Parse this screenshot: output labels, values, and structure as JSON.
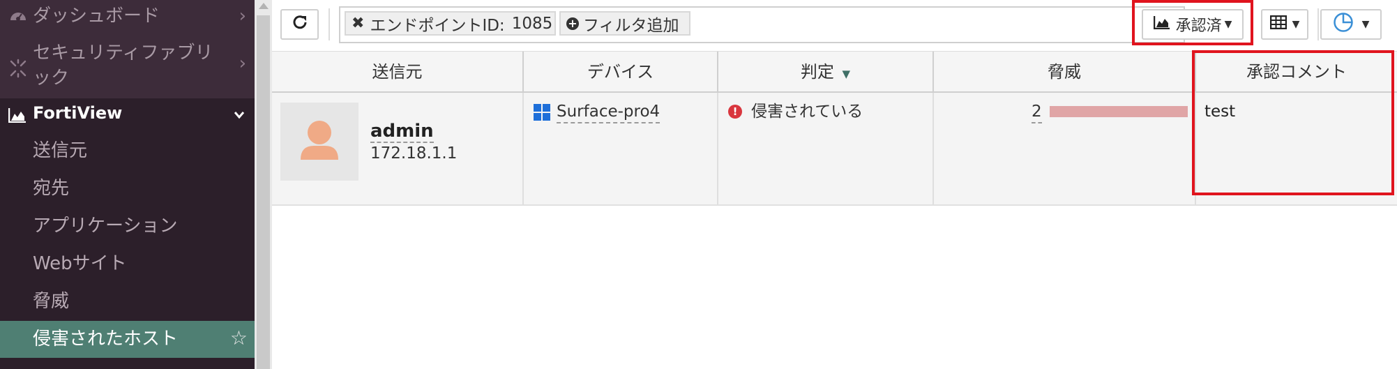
{
  "sidebar": {
    "items": [
      {
        "label": "ダッシュボード",
        "icon": "dashboard-icon"
      },
      {
        "label_line1": "セキュリティファブリ",
        "label_line2": "ック",
        "icon": "security-fabric-icon"
      }
    ],
    "fortiview": {
      "label": "FortiView",
      "icon": "area-chart-icon"
    },
    "subitems": [
      {
        "label": "送信元"
      },
      {
        "label": "宛先"
      },
      {
        "label": "アプリケーション"
      },
      {
        "label": "Webサイト"
      },
      {
        "label": "脅威"
      },
      {
        "label": "侵害されたホスト",
        "active": true
      }
    ],
    "colors": {
      "background": "#2c1f2a",
      "active": "#4f7f73"
    }
  },
  "toolbar": {
    "refresh_icon": "refresh-icon",
    "filter_chip": {
      "key": "エンドポイントID:",
      "value": "1085"
    },
    "add_filter_label": "フィルタ追加",
    "status_dropdown_label": "承認済",
    "grid_icon": "table-grid-icon",
    "chart_icon": "pie-chart-icon"
  },
  "table": {
    "columns": [
      "送信元",
      "デバイス",
      "判定",
      "脅威",
      "承認コメント"
    ],
    "sort_column": "判定",
    "rows": [
      {
        "user": "admin",
        "ip": "172.18.1.1",
        "device": "Surface-pro4",
        "device_icon": "windows-icon",
        "verdict": "侵害されている",
        "threat_count": "2",
        "threat_level": 1.0,
        "comment": "test"
      }
    ]
  },
  "highlight_color": "#e0141e"
}
